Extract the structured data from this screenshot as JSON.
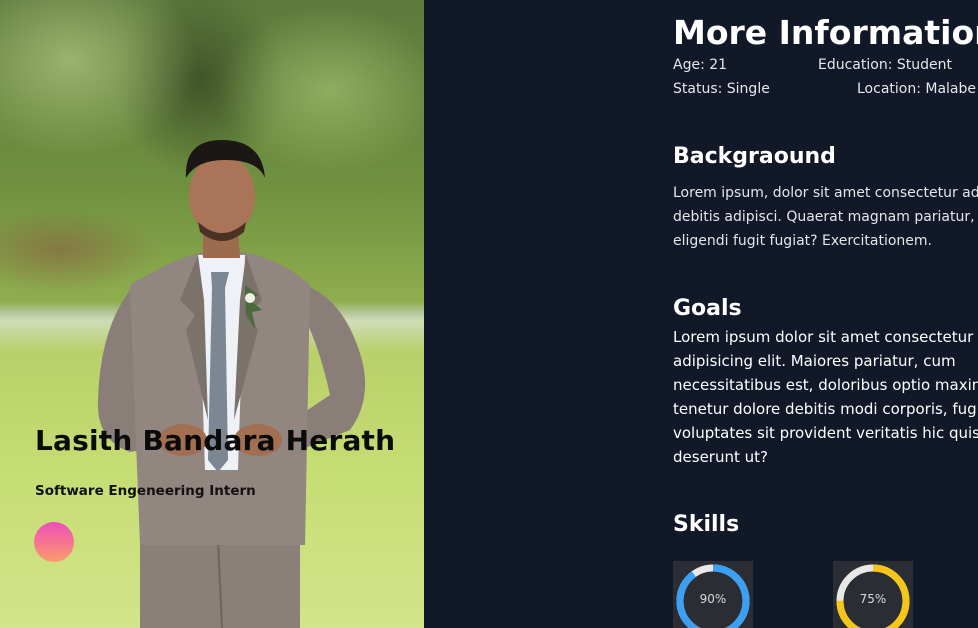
{
  "profile": {
    "name": "Lasith Bandara Herath",
    "role": "Software Engeneering Intern"
  },
  "info": {
    "title": "More Information",
    "age": "Age: 21",
    "education": "Education: Student",
    "status": "Status: Single",
    "location": "Location: Malabe"
  },
  "background": {
    "title": "Backgraound",
    "lines": [
      "Lorem ipsum, dolor sit amet consectetur adipi",
      "debitis adipisci. Quaerat magnam pariatur, dis",
      "eligendi fugit fugiat? Exercitationem."
    ]
  },
  "goals": {
    "title": "Goals",
    "lines": [
      "Lorem ipsum dolor sit amet consectetur",
      "adipisicing elit. Maiores pariatur, cum",
      "necessitatibus est, doloribus optio maxime",
      "tenetur dolore debitis modi corporis, fugit",
      "voluptates sit provident veritatis hic quis",
      "deserunt ut?"
    ]
  },
  "skills": {
    "title": "Skills",
    "items": [
      {
        "value_label": "90%",
        "percent": 90,
        "color": "#3b9ff3"
      },
      {
        "value_label": "75%",
        "percent": 75,
        "color": "#f5c518"
      }
    ]
  },
  "colors": {
    "page_background": "#111827",
    "accent_dot_top": "#ee4fb9",
    "accent_dot_bottom": "#fb9a6b"
  }
}
